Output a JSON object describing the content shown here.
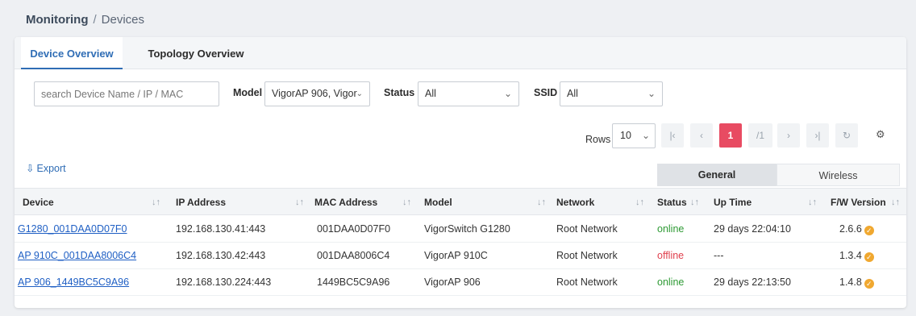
{
  "breadcrumb": {
    "first": "Monitoring",
    "separator": "/",
    "second": "Devices"
  },
  "tabs": [
    {
      "label": "Device Overview",
      "active": true
    },
    {
      "label": "Topology Overview",
      "active": false
    }
  ],
  "filters": {
    "search_placeholder": "search Device Name / IP / MAC",
    "model_label": "Model",
    "model_value": "VigorAP 906, Vigor",
    "status_label": "Status",
    "status_value": "All",
    "ssid_label": "SSID",
    "ssid_value": "All"
  },
  "pagination": {
    "rows_label": "Rows",
    "rows_value": "10",
    "current_page": "1",
    "total_pages": "/1"
  },
  "export_label": "Export",
  "view_tabs": {
    "general": "General",
    "wireless": "Wireless"
  },
  "columns": [
    "Device",
    "IP Address",
    "MAC Address",
    "Model",
    "Network",
    "Status",
    "Up Time",
    "F/W Version"
  ],
  "rows": [
    {
      "device": "G1280_001DAA0D07F0",
      "ip": "192.168.130.41:443",
      "mac": "001DAA0D07F0",
      "model": "VigorSwitch G1280",
      "network": "Root Network",
      "status": "online",
      "uptime": "29 days 22:04:10",
      "fw": "2.6.6"
    },
    {
      "device": "AP 910C_001DAA8006C4",
      "ip": "192.168.130.42:443",
      "mac": "001DAA8006C4",
      "model": "VigorAP 910C",
      "network": "Root Network",
      "status": "offline",
      "uptime": "---",
      "fw": "1.3.4"
    },
    {
      "device": "AP 906_1449BC5C9A96",
      "ip": "192.168.130.224:443",
      "mac": "1449BC5C9A96",
      "model": "VigorAP 906",
      "network": "Root Network",
      "status": "online",
      "uptime": "29 days 22:13:50",
      "fw": "1.4.8"
    }
  ],
  "colors": {
    "accent": "#2f6db5",
    "active_page": "#e84b62",
    "online": "#2e9a34",
    "offline": "#e0404e",
    "fw_badge": "#f0a830"
  }
}
